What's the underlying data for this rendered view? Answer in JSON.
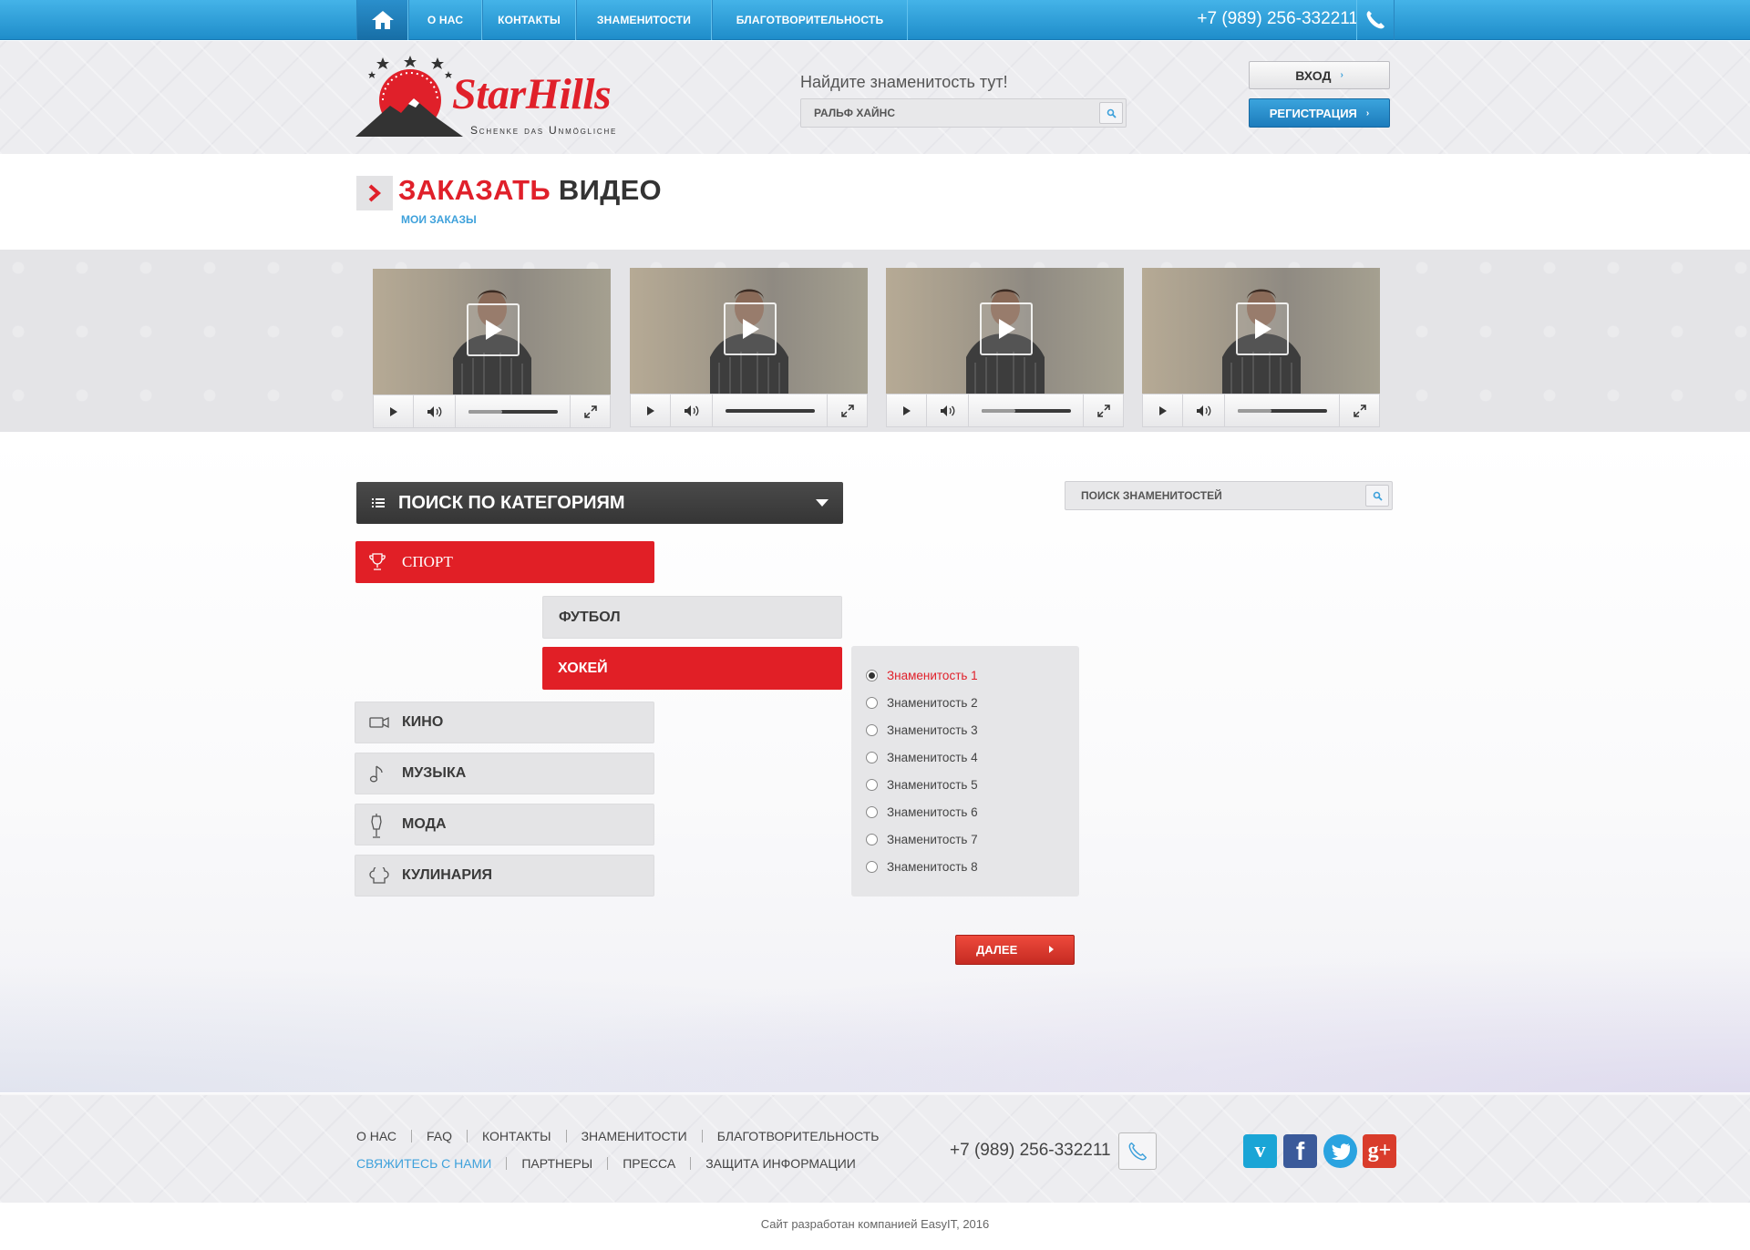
{
  "nav": {
    "items": [
      "О НАС",
      "КОНТАКТЫ",
      "ЗНАМЕНИТОСТИ",
      "БЛАГОТВОРИТЕЛЬНОСТЬ"
    ],
    "phone": "+7 (989) 256-332211"
  },
  "brand": {
    "name": "StarHills",
    "tagline": "Schenke das Unmögliche",
    "color": "#e0202a"
  },
  "header": {
    "search_label": "Найдите знаменитость тут!",
    "search_value": "РАЛЬФ ХАЙНС",
    "login_label": "ВХОД",
    "register_label": "РЕГИСТРАЦИЯ"
  },
  "page": {
    "title_red": "ЗАКАЗАТЬ",
    "title_dark": "ВИДЕО",
    "my_orders": "МОИ ЗАКАЗЫ"
  },
  "videos": [
    {
      "progress": 0.38
    },
    {
      "progress": 0.0
    },
    {
      "progress": 0.38
    },
    {
      "progress": 0.38
    }
  ],
  "categories": {
    "header": "ПОИСК ПО КАТЕГОРИЯМ",
    "items": [
      {
        "label": "СПОРТ",
        "icon": "trophy-icon",
        "active": true
      },
      {
        "label": "КИНО",
        "icon": "video-camera-icon"
      },
      {
        "label": "МУЗЫКА",
        "icon": "music-note-icon"
      },
      {
        "label": "МОДА",
        "icon": "mannequin-icon"
      },
      {
        "label": "КУЛИНАРИЯ",
        "icon": "chef-hat-icon"
      }
    ],
    "subcategories": [
      {
        "label": "ФУТБОЛ",
        "active": false
      },
      {
        "label": "ХОКЕЙ",
        "active": true
      }
    ]
  },
  "celebrities": [
    {
      "label": "Знаменитость 1",
      "selected": true
    },
    {
      "label": "Знаменитость 2"
    },
    {
      "label": "Знаменитость 3"
    },
    {
      "label": "Знаменитость 4"
    },
    {
      "label": "Знаменитость 5"
    },
    {
      "label": "Знаменитость 6"
    },
    {
      "label": "Знаменитость 7"
    },
    {
      "label": "Знаменитость 8"
    }
  ],
  "next_label": "ДАЛЕЕ",
  "celeb_search_placeholder": "ПОИСК ЗНАМЕНИТОСТЕЙ",
  "footer": {
    "row1": [
      "О НАС",
      "FAQ",
      "КОНТАКТЫ",
      "ЗНАМЕНИТОСТИ",
      "БЛАГОТВОРИТЕЛЬНОСТЬ"
    ],
    "row2": [
      "СВЯЖИТЕСЬ С НАМИ",
      "ПАРТНЕРЫ",
      "ПРЕССА",
      "ЗАЩИТА ИНФОРМАЦИИ"
    ],
    "phone": "+7 (989) 256-332211",
    "social": [
      "vimeo-icon",
      "facebook-icon",
      "twitter-icon",
      "google-plus-icon"
    ],
    "copyright": "Сайт разработан компанией EasyIT, 2016"
  },
  "colors": {
    "accent_red": "#e11f26",
    "accent_blue": "#3ea1db",
    "dark": "#3a3a3a"
  }
}
